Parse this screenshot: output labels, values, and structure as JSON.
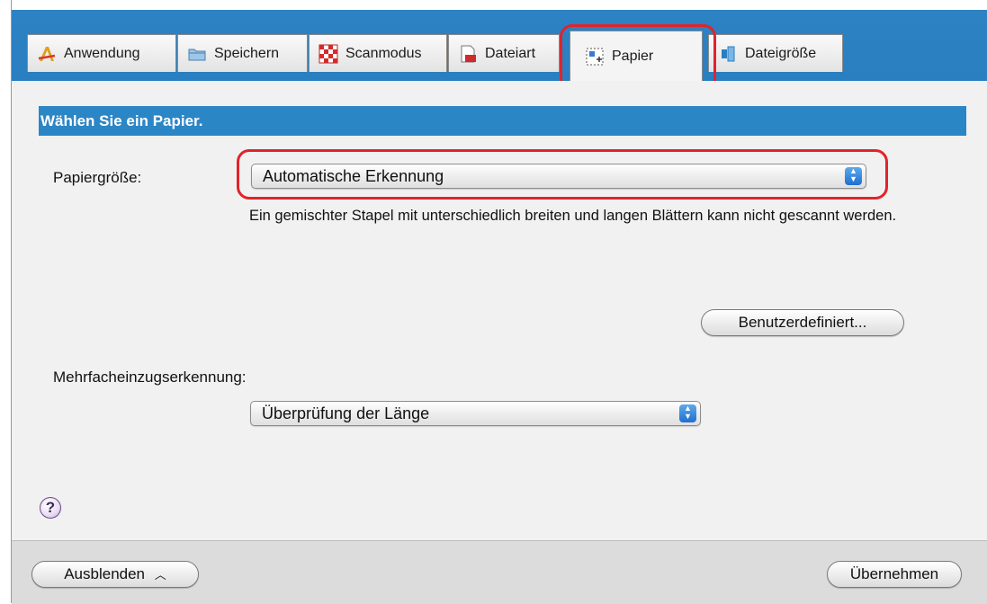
{
  "tabs": [
    {
      "label": "Anwendung",
      "icon": "application-icon"
    },
    {
      "label": "Speichern",
      "icon": "folder-icon"
    },
    {
      "label": "Scanmodus",
      "icon": "scan-mode-icon"
    },
    {
      "label": "Dateiart",
      "icon": "file-type-icon"
    },
    {
      "label": "Papier",
      "icon": "paper-icon",
      "active": true
    },
    {
      "label": "Dateigröße",
      "icon": "file-size-icon"
    }
  ],
  "banner": "Wählen Sie ein Papier.",
  "paper_size": {
    "label": "Papiergröße:",
    "value": "Automatische Erkennung"
  },
  "note": "Ein gemischter Stapel mit unterschiedlich breiten und langen Blättern kann nicht gescannt werden.",
  "custom_button": "Benutzerdefiniert...",
  "multifeed": {
    "label": "Mehrfacheinzugserkennung:",
    "value": "Überprüfung der Länge"
  },
  "help": "?",
  "footer": {
    "hide_button": "Ausblenden",
    "apply_button": "Übernehmen"
  },
  "colors": {
    "accent_blue": "#2b86c6",
    "highlight_red": "#e2232a"
  }
}
